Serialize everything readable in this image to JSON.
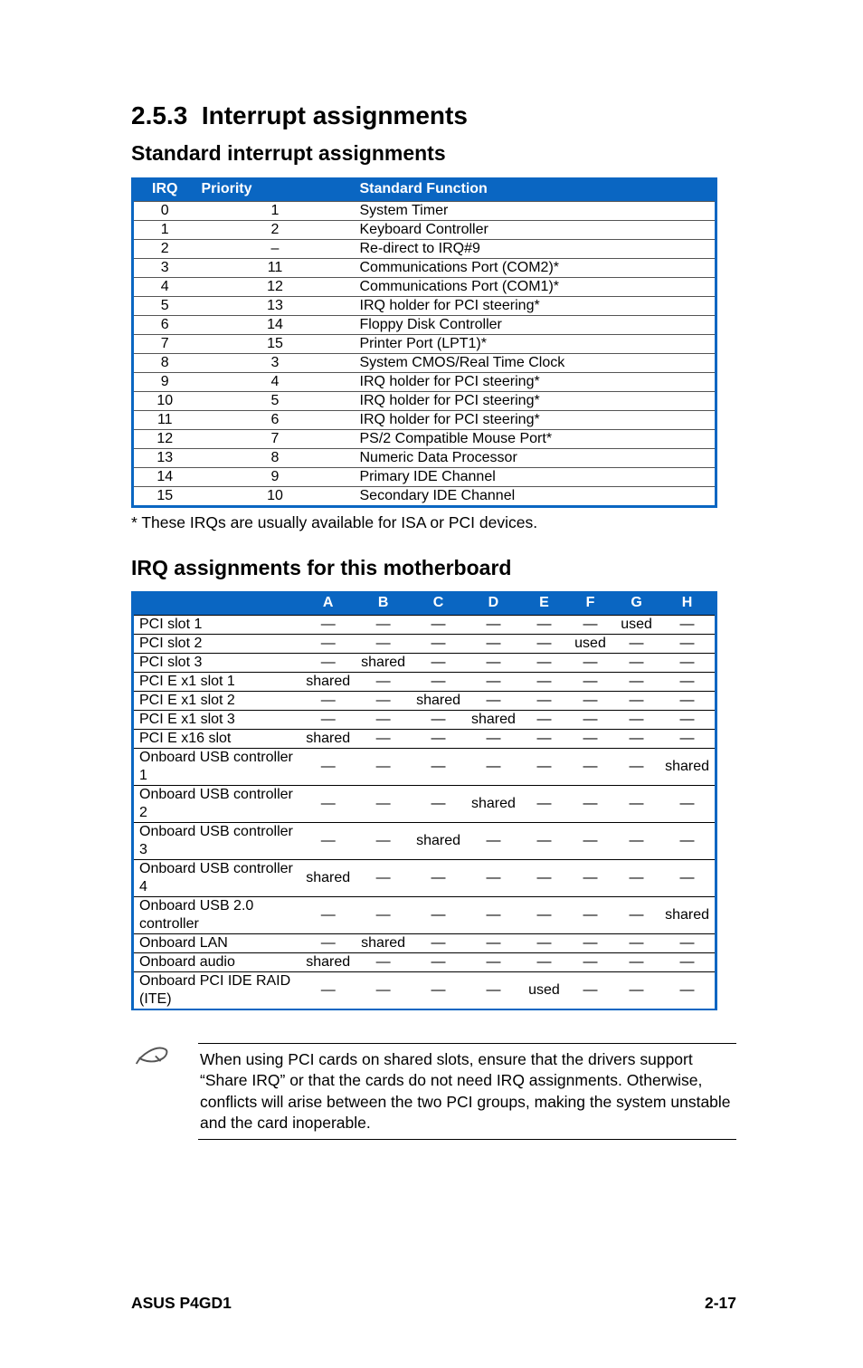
{
  "heading_number": "2.5.3",
  "heading_title": "Interrupt assignments",
  "sub1": "Standard interrupt assignments",
  "std_head": {
    "irq": "IRQ",
    "priority": "Priority",
    "func": "Standard Function"
  },
  "std_rows": [
    {
      "irq": "0",
      "pri": "1",
      "func": "System Timer"
    },
    {
      "irq": "1",
      "pri": "2",
      "func": "Keyboard Controller"
    },
    {
      "irq": "2",
      "pri": "–",
      "func": "Re-direct to IRQ#9"
    },
    {
      "irq": "3",
      "pri": "11",
      "func": "Communications Port (COM2)*"
    },
    {
      "irq": "4",
      "pri": "12",
      "func": "Communications Port (COM1)*"
    },
    {
      "irq": "5",
      "pri": "13",
      "func": "IRQ holder for PCI steering*"
    },
    {
      "irq": "6",
      "pri": "14",
      "func": "Floppy Disk Controller"
    },
    {
      "irq": "7",
      "pri": "15",
      "func": "Printer Port (LPT1)*"
    },
    {
      "irq": "8",
      "pri": "3",
      "func": "System CMOS/Real Time Clock"
    },
    {
      "irq": "9",
      "pri": "4",
      "func": "IRQ holder for PCI steering*"
    },
    {
      "irq": "10",
      "pri": "5",
      "func": "IRQ holder for PCI steering*"
    },
    {
      "irq": "11",
      "pri": "6",
      "func": "IRQ holder for PCI steering*"
    },
    {
      "irq": "12",
      "pri": "7",
      "func": "PS/2 Compatible Mouse Port*"
    },
    {
      "irq": "13",
      "pri": "8",
      "func": "Numeric Data Processor"
    },
    {
      "irq": "14",
      "pri": "9",
      "func": "Primary IDE Channel"
    },
    {
      "irq": "15",
      "pri": "10",
      "func": "Secondary IDE Channel"
    }
  ],
  "std_footnote": "* These IRQs are usually available for ISA or PCI devices.",
  "sub2": "IRQ assignments for this motherboard",
  "mb_cols": [
    "A",
    "B",
    "C",
    "D",
    "E",
    "F",
    "G",
    "H"
  ],
  "mb_rows": [
    {
      "label": "PCI slot 1",
      "cells": [
        "—",
        "—",
        "—",
        "—",
        "—",
        "—",
        "used",
        "—"
      ]
    },
    {
      "label": "PCI slot 2",
      "cells": [
        "—",
        "—",
        "—",
        "—",
        "—",
        "used",
        "—",
        "—"
      ]
    },
    {
      "label": "PCI slot 3",
      "cells": [
        "—",
        "shared",
        "—",
        "—",
        "—",
        "—",
        "—",
        "—"
      ]
    },
    {
      "label": "PCI E x1 slot 1",
      "cells": [
        "shared",
        "—",
        "—",
        "—",
        "—",
        "—",
        "—",
        "—"
      ]
    },
    {
      "label": "PCI E x1 slot 2",
      "cells": [
        "—",
        "—",
        "shared",
        "—",
        "—",
        "—",
        "—",
        "—"
      ]
    },
    {
      "label": "PCI E x1 slot 3",
      "cells": [
        "—",
        "—",
        "—",
        "shared",
        "—",
        "—",
        "—",
        "—"
      ]
    },
    {
      "label": "PCI E x16 slot",
      "cells": [
        "shared",
        "—",
        "—",
        "—",
        "—",
        "—",
        "—",
        "—"
      ]
    },
    {
      "label": "Onboard USB controller 1",
      "cells": [
        "—",
        "—",
        "—",
        "—",
        "—",
        "—",
        "—",
        "shared"
      ]
    },
    {
      "label": "Onboard USB controller 2",
      "cells": [
        "—",
        "—",
        "—",
        "shared",
        "—",
        "—",
        "—",
        "—"
      ]
    },
    {
      "label": "Onboard USB controller 3",
      "cells": [
        "—",
        "—",
        "shared",
        "—",
        "—",
        "—",
        "—",
        "—"
      ]
    },
    {
      "label": "Onboard USB controller 4",
      "cells": [
        "shared",
        "—",
        "—",
        "—",
        "—",
        "—",
        "—",
        "—"
      ]
    },
    {
      "label": "Onboard USB 2.0 controller",
      "cells": [
        "—",
        "—",
        "—",
        "—",
        "—",
        "—",
        "—",
        "shared"
      ]
    },
    {
      "label": "Onboard LAN",
      "cells": [
        "—",
        "shared",
        "—",
        "—",
        "—",
        "—",
        "—",
        "—"
      ]
    },
    {
      "label": "Onboard audio",
      "cells": [
        "shared",
        "—",
        "—",
        "—",
        "—",
        "—",
        "—",
        "—"
      ]
    },
    {
      "label": "Onboard PCI IDE RAID (ITE)",
      "cells": [
        "—",
        "—",
        "—",
        "—",
        "used",
        "—",
        "—",
        "—"
      ]
    }
  ],
  "note_text": "When using PCI cards on shared slots, ensure that the drivers support “Share IRQ” or that the cards do not need IRQ assignments. Otherwise, conflicts will arise between the two PCI groups, making the system unstable and the card inoperable.",
  "footer_left": "ASUS P4GD1",
  "footer_right": "2-17"
}
